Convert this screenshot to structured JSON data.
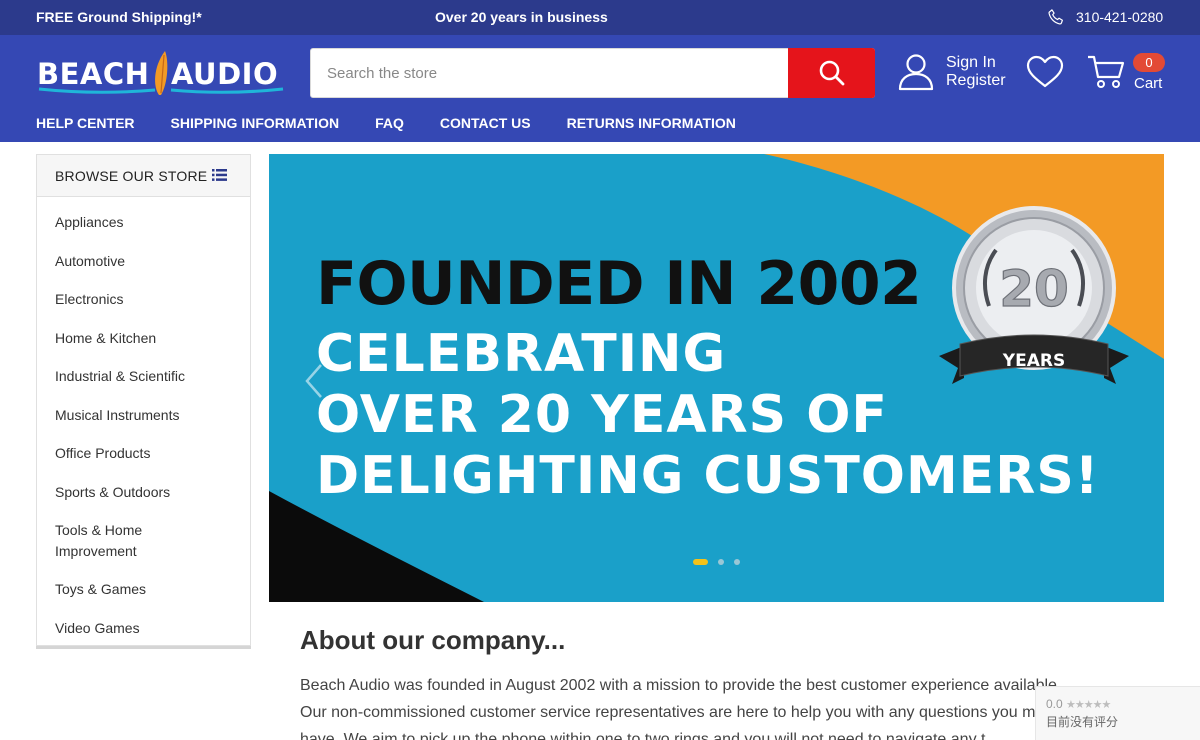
{
  "topbar": {
    "shipping": "FREE Ground Shipping!*",
    "years": "Over 20 years in business",
    "phone": "310-421-0280"
  },
  "header": {
    "logo_text": "BEACH AUDIO",
    "search_placeholder": "Search the store",
    "sign_in": "Sign In",
    "register": "Register",
    "cart_count": "0",
    "cart_label": "Cart"
  },
  "nav": [
    "HELP CENTER",
    "SHIPPING INFORMATION",
    "FAQ",
    "CONTACT US",
    "RETURNS INFORMATION"
  ],
  "sidebar": {
    "title": "BROWSE OUR STORE",
    "items": [
      "Appliances",
      "Automotive",
      "Electronics",
      "Home & Kitchen",
      "Industrial & Scientific",
      "Musical Instruments",
      "Office Products",
      "Sports & Outdoors",
      "Tools & Home Improvement",
      "Toys & Games",
      "Video Games"
    ]
  },
  "hero": {
    "headline": "FOUNDED IN 2002",
    "line1": "CELEBRATING",
    "line2": "OVER 20 YEARS OF",
    "line3": "DELIGHTING CUSTOMERS!",
    "badge_number": "20",
    "badge_label": "YEARS",
    "slide_count": 3,
    "active_slide": 1
  },
  "about": {
    "title": "About our company...",
    "lines": [
      "Beach Audio was founded in August 2002 with a mission to provide the best customer experience available.",
      "Our non-commissioned customer service representatives are here to help you with any questions you may",
      "have. We aim to pick up the phone within one to two rings and you will not need to navigate any t"
    ]
  },
  "rating_widget": {
    "score": "0.0",
    "stars": "★★★★★",
    "message": "目前没有评分"
  },
  "colors": {
    "topbar": "#2c3a8c",
    "header": "#3548b4",
    "search_button": "#e5141b",
    "cart_badge": "#e34a35",
    "hero_blue": "#1aa0c9",
    "hero_orange": "#f39a25"
  }
}
